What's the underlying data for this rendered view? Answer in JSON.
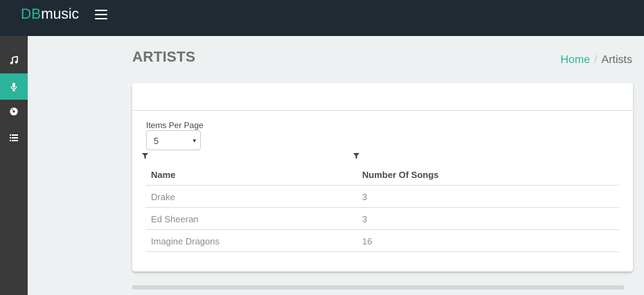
{
  "app": {
    "logo_accent": "DB",
    "logo_rest": "music"
  },
  "sidebar": {
    "items": [
      {
        "icon": "music-note-icon",
        "active": false
      },
      {
        "icon": "microphone-icon",
        "active": true
      },
      {
        "icon": "disc-icon",
        "active": false
      },
      {
        "icon": "list-icon",
        "active": false
      }
    ]
  },
  "page": {
    "title": "ARTISTS"
  },
  "breadcrumb": {
    "home": "Home",
    "separator": "/",
    "current": "Artists"
  },
  "pagination": {
    "label": "Items Per Page",
    "selected": "5",
    "arrow": "▾"
  },
  "table": {
    "columns": [
      "Name",
      "Number Of Songs"
    ],
    "rows": [
      [
        "Drake",
        "3"
      ],
      [
        "Ed Sheeran",
        "3"
      ],
      [
        "Imagine Dragons",
        "16"
      ]
    ]
  },
  "colors": {
    "accent": "#2bb39b",
    "topbar": "#1f2a33",
    "sidebar": "#3a3a3a",
    "background": "#eef1f1"
  }
}
